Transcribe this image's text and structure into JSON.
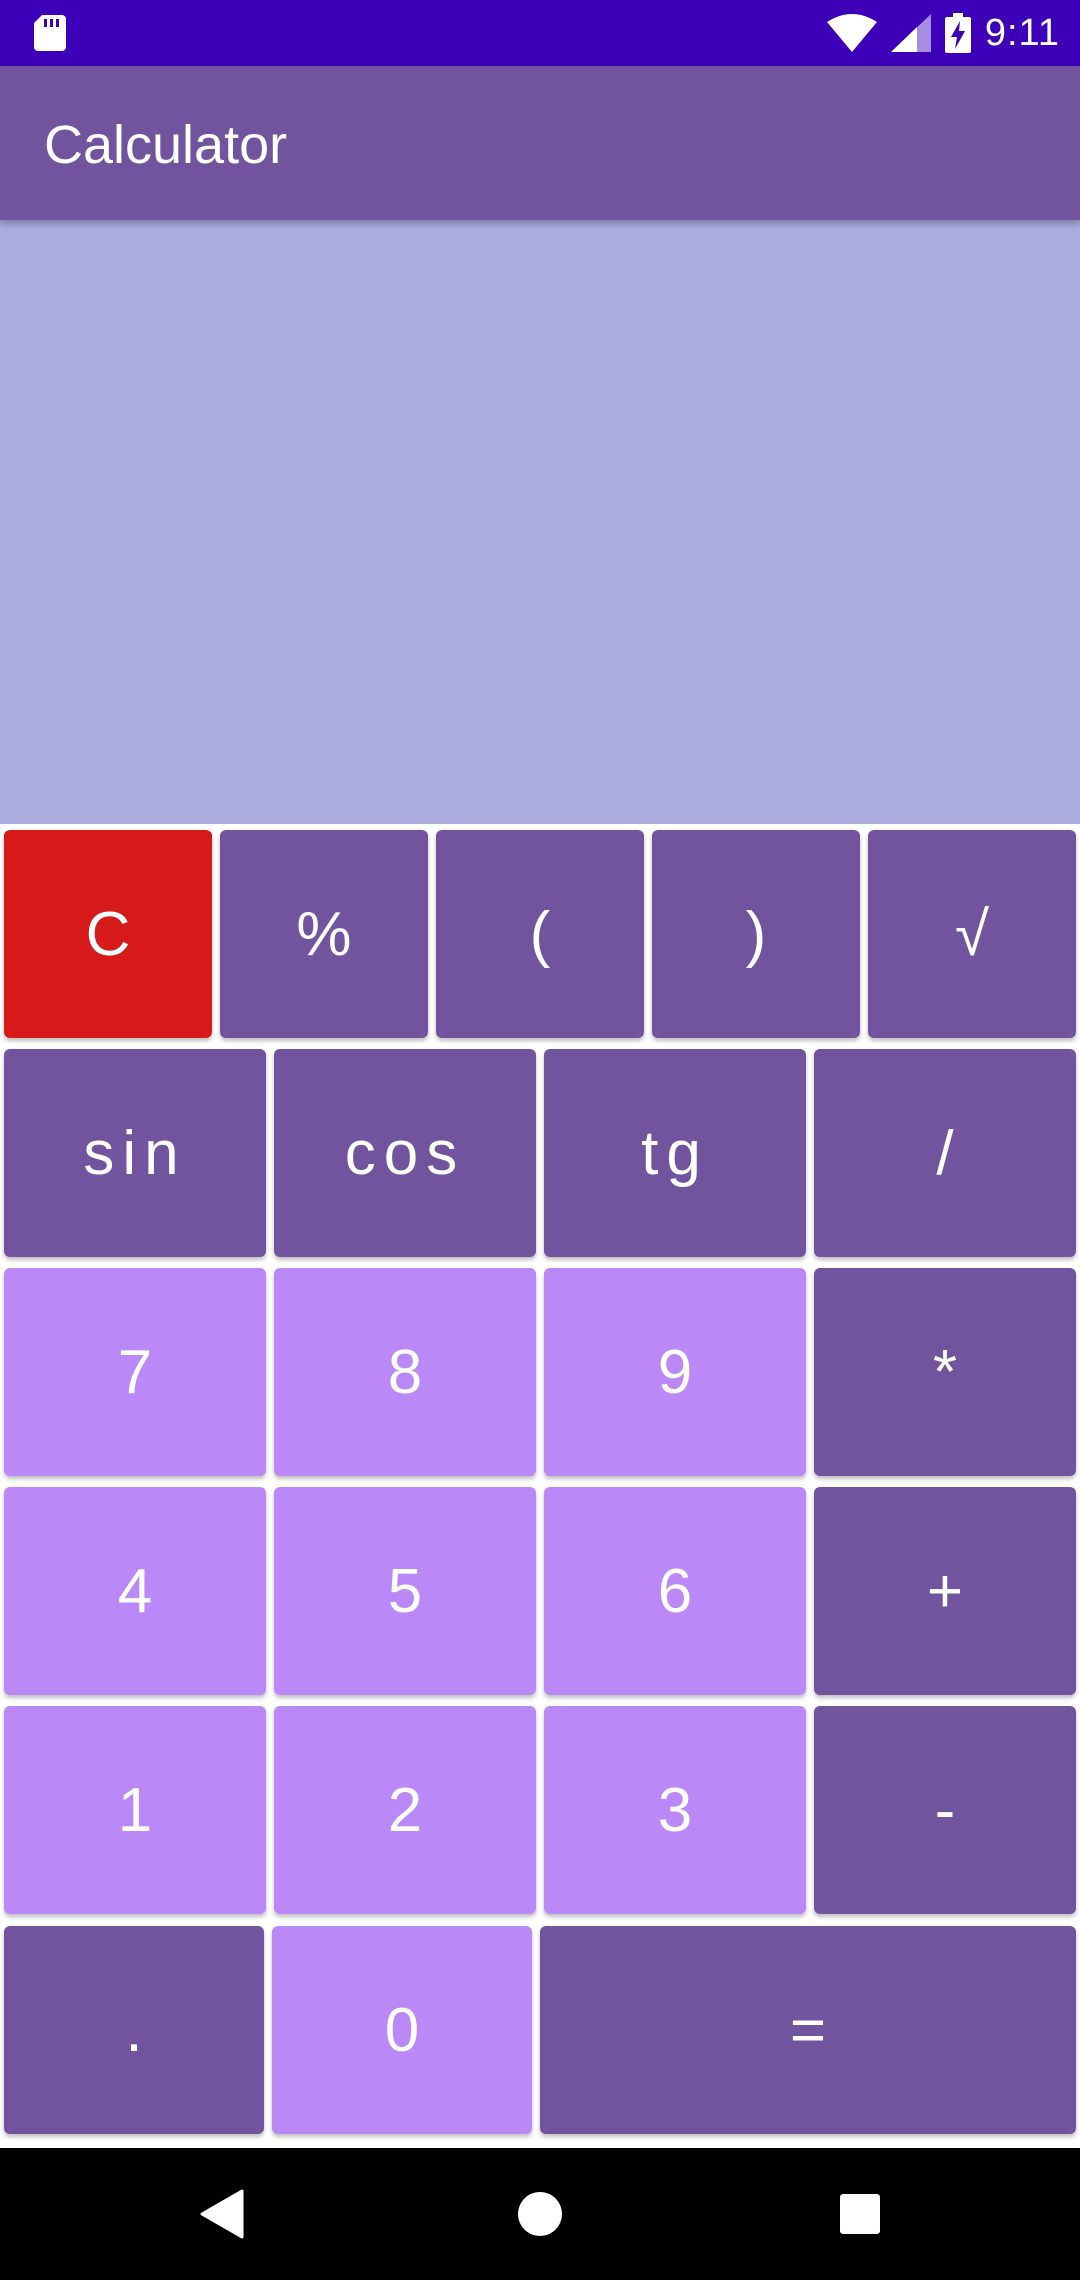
{
  "status_bar": {
    "time": "9:11",
    "icons": [
      "sd-card-icon",
      "wifi-icon",
      "cell-signal-icon",
      "battery-charging-icon"
    ]
  },
  "app_bar": {
    "title": "Calculator"
  },
  "display": {
    "expression": ""
  },
  "keypad": {
    "rows": [
      [
        "C",
        "%",
        "(",
        ")",
        "√"
      ],
      [
        "sin",
        "cos",
        "tg",
        "/"
      ],
      [
        "7",
        "8",
        "9",
        "*"
      ],
      [
        "4",
        "5",
        "6",
        "+"
      ],
      [
        "1",
        "2",
        "3",
        "-"
      ],
      [
        ".",
        "0",
        "="
      ]
    ]
  },
  "colors": {
    "status_bar": "#3d00b8",
    "app_bar": "#71549d",
    "display": "#acacdf",
    "operator_key": "#71549d",
    "digit_key": "#bb88f8",
    "clear_key": "#d61919"
  },
  "nav_bar": {
    "icons": [
      "back-icon",
      "home-icon",
      "recents-icon"
    ]
  }
}
